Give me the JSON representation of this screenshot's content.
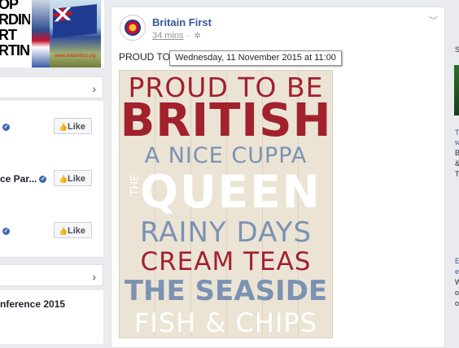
{
  "left": {
    "thumb_text": "OP\nRDIN\nRT\nRTING",
    "thumb_watermark": "www.britainfirst.org",
    "suggested_pages": [
      {
        "name": "",
        "like_label": "Like"
      },
      {
        "name": "ce Par...",
        "like_label": "Like"
      },
      {
        "name": "",
        "like_label": "Like"
      }
    ],
    "event_name": "nference 2015"
  },
  "post": {
    "page_name": "Britain First",
    "time": "34 mins",
    "separator": "·",
    "text": "PROUD TO",
    "tooltip": "Wednesday, 11 November 2015 at 11:00",
    "poster_lines": [
      {
        "text": "PROUD TO BE",
        "color": "#a1212d"
      },
      {
        "text": "BRITISH",
        "color": "#a1212d"
      },
      {
        "text": "A NICE CUPPA",
        "color": "#7c92b2"
      },
      {
        "text": "THE",
        "color": "#ffffff"
      },
      {
        "text": "QUEEN",
        "color": "#ffffff"
      },
      {
        "text": "RAINY DAYS",
        "color": "#7c92b2"
      },
      {
        "text": "CREAM TEAS",
        "color": "#a1212d"
      },
      {
        "text": "THE SEASIDE",
        "color": "#7c92b2"
      },
      {
        "text": "FISH & CHIPS",
        "color": "#ffffff"
      }
    ]
  },
  "right": {
    "letters": [
      "S",
      "T",
      "w",
      "B",
      "&",
      "T",
      "E",
      "e",
      "W",
      "o",
      "o"
    ]
  },
  "colors": {
    "facebook_blue": "#365899",
    "page_background": "#e9ebee",
    "poster_red": "#a1212d",
    "poster_blue": "#7c92b2"
  }
}
